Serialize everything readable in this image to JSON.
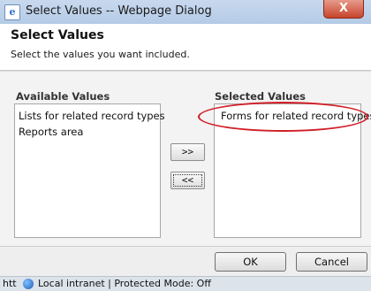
{
  "window": {
    "title": "Select Values -- Webpage Dialog",
    "close_glyph": "X",
    "icon": "ie-page-icon"
  },
  "header": {
    "title": "Select Values",
    "description": "Select the values you want included."
  },
  "available": {
    "label": "Available Values",
    "items": [
      "Lists for related record types",
      "Reports area"
    ]
  },
  "selected": {
    "label": "Selected Values",
    "items": [
      "Forms for related record types"
    ]
  },
  "move": {
    "add_label": ">>",
    "remove_label": "<<"
  },
  "footer": {
    "ok_label": "OK",
    "cancel_label": "Cancel"
  },
  "status": {
    "prefix": "htt",
    "zone": "Local intranet | Protected Mode: Off"
  },
  "colors": {
    "highlight": "#d21f27"
  }
}
